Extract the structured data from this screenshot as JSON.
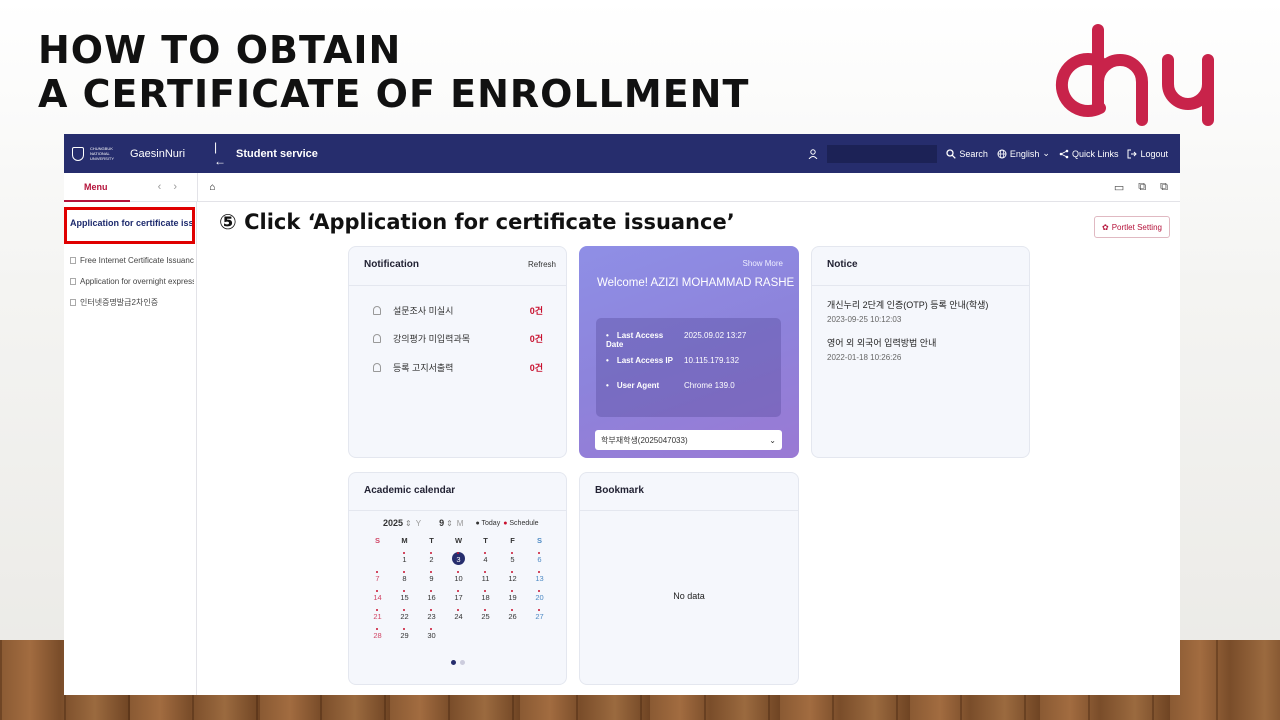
{
  "slide": {
    "title_line1": "HOW TO OBTAIN",
    "title_line2": "A CERTIFICATE OF ENROLLMENT",
    "instruction": "⑤ Click ‘Application for certificate issuance’",
    "logo_icon": "cbnu-logo",
    "logo_color": "#c8234a"
  },
  "topbar": {
    "university": "CHUNGBUK NATIONAL UNIVERSITY",
    "system_name": "GaesinNuri",
    "collapse_icon": "collapse-left-icon",
    "service": "Student service",
    "search": "Search",
    "language": "English",
    "quick_links": "Quick Links",
    "logout": "Logout",
    "bg_color": "#262d6d"
  },
  "subbar": {
    "menu_tab": "Menu",
    "prev": "‹",
    "next": "›"
  },
  "sidebar": {
    "active_item": "Application for certificate issuance",
    "items": [
      "Free Internet Certificate Issuance",
      "Application for overnight express",
      "인터넷증명발급2차인증"
    ]
  },
  "portlet_setting": "Portlet Setting",
  "notification": {
    "title": "Notification",
    "refresh": "Refresh",
    "items": [
      {
        "label": "설문조사 미실시",
        "count": "0건"
      },
      {
        "label": "강의평가 미입력과목",
        "count": "0건"
      },
      {
        "label": "등록 고지서출력",
        "count": "0건"
      }
    ]
  },
  "welcome": {
    "show_more": "Show More",
    "greeting": "Welcome! AZIZI MOHAMMAD RASHE",
    "last_access_date_label": "Last Access Date",
    "last_access_date": "2025.09.02 13:27",
    "last_access_ip_label": "Last Access IP",
    "last_access_ip": "10.115.179.132",
    "user_agent_label": "User Agent",
    "user_agent": "Chrome 139.0",
    "student_select": "학부재학생(2025047033)"
  },
  "notice": {
    "title": "Notice",
    "items": [
      {
        "title": "개신누리 2단계 인증(OTP) 등록 안내(학생)",
        "date": "2023-09-25 10:12:03"
      },
      {
        "title": "영어 외 외국어 입력방법 안내",
        "date": "2022-01-18 10:26:26"
      }
    ]
  },
  "calendar": {
    "title": "Academic calendar",
    "year": "2025",
    "year_unit": "Y",
    "month": "9",
    "month_unit": "M",
    "legend_today": "Today",
    "legend_schedule": "Schedule",
    "weekdays": [
      "S",
      "M",
      "T",
      "W",
      "T",
      "F",
      "S"
    ],
    "weeks": [
      [
        "",
        "1",
        "2",
        "3",
        "4",
        "5",
        "6"
      ],
      [
        "7",
        "8",
        "9",
        "10",
        "11",
        "12",
        "13"
      ],
      [
        "14",
        "15",
        "16",
        "17",
        "18",
        "19",
        "20"
      ],
      [
        "21",
        "22",
        "23",
        "24",
        "25",
        "26",
        "27"
      ],
      [
        "28",
        "29",
        "30",
        "",
        "",
        "",
        ""
      ]
    ],
    "today": "3"
  },
  "bookmark": {
    "title": "Bookmark",
    "empty": "No data"
  }
}
